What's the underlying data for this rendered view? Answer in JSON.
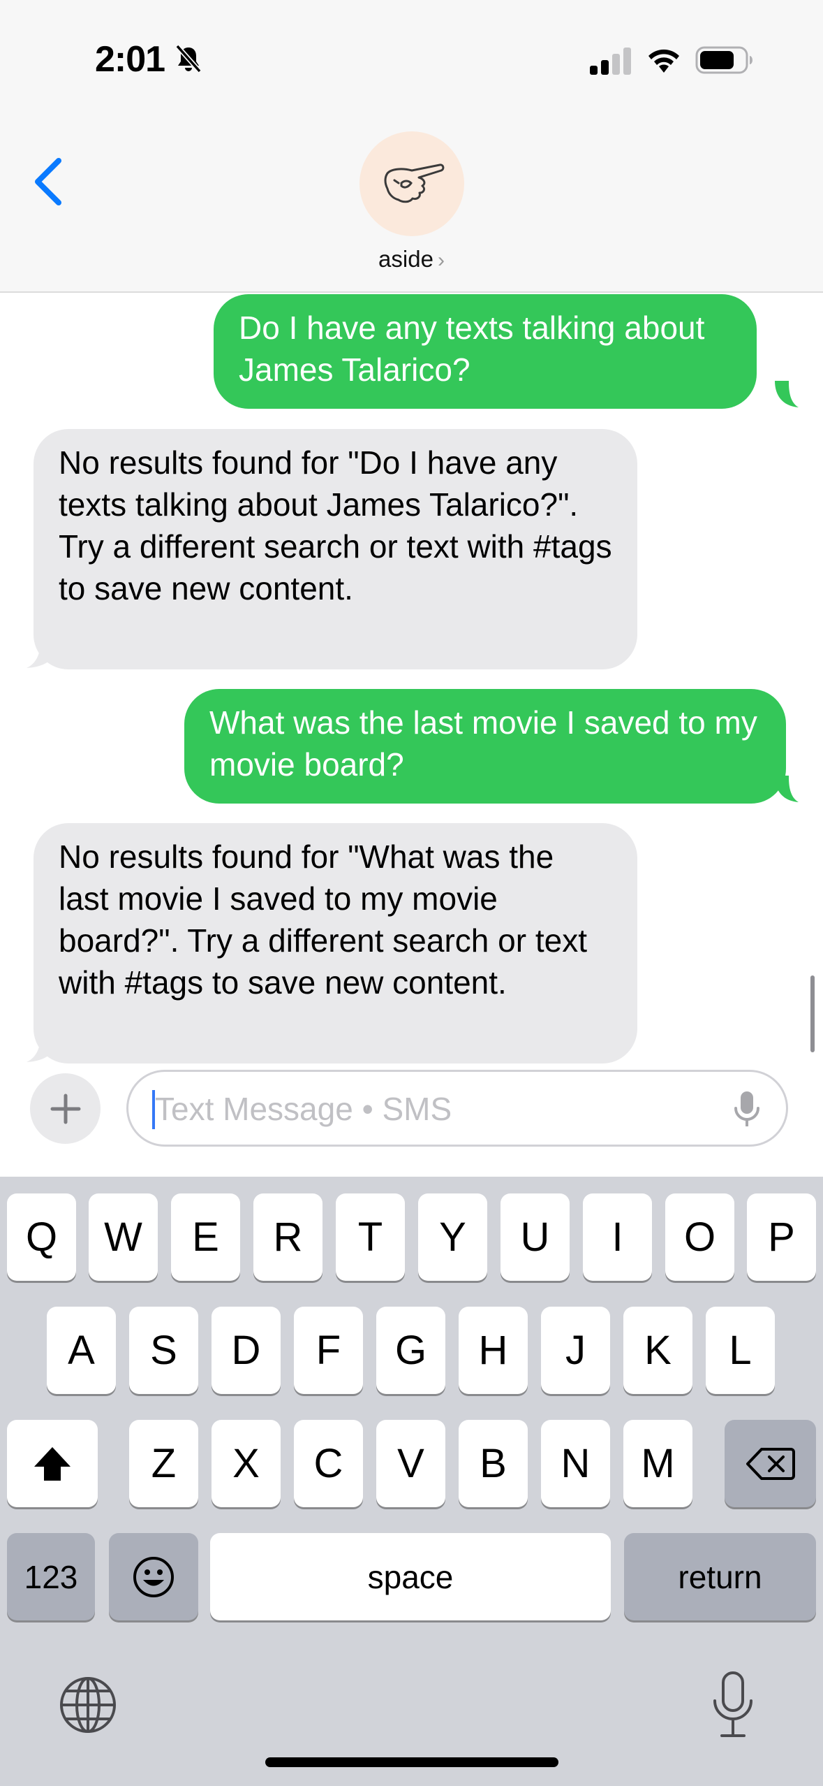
{
  "status_bar": {
    "time": "2:01",
    "icons": [
      "bell-slash-icon",
      "cellular-signal-icon",
      "wifi-icon",
      "battery-icon"
    ]
  },
  "header": {
    "back_icon": "chevron-left-icon",
    "contact_name": "aside",
    "contact_chevron": "›"
  },
  "messages": [
    {
      "direction": "outgoing",
      "text": "Do I have any texts talking about James Talarico?"
    },
    {
      "direction": "incoming",
      "text": "No results found for \"Do I have any texts talking about James Talarico?\". Try a different search or text with #tags to save new content."
    },
    {
      "direction": "outgoing",
      "text": "What was the last movie I saved to my movie board?"
    },
    {
      "direction": "incoming",
      "text": "No results found for \"What was the last movie I saved to my movie board?\". Try a different search or text with #tags to save new content."
    }
  ],
  "composer": {
    "placeholder": "Text Message • SMS",
    "value": ""
  },
  "keyboard": {
    "row1": [
      "Q",
      "W",
      "E",
      "R",
      "T",
      "Y",
      "U",
      "I",
      "O",
      "P"
    ],
    "row2": [
      "A",
      "S",
      "D",
      "F",
      "G",
      "H",
      "J",
      "K",
      "L"
    ],
    "row3": [
      "Z",
      "X",
      "C",
      "V",
      "B",
      "N",
      "M"
    ],
    "numbers_key": "123",
    "space_key": "space",
    "return_key": "return"
  },
  "colors": {
    "outgoing_bubble": "#34c759",
    "incoming_bubble": "#e9e9eb",
    "accent": "#0a7aff"
  }
}
